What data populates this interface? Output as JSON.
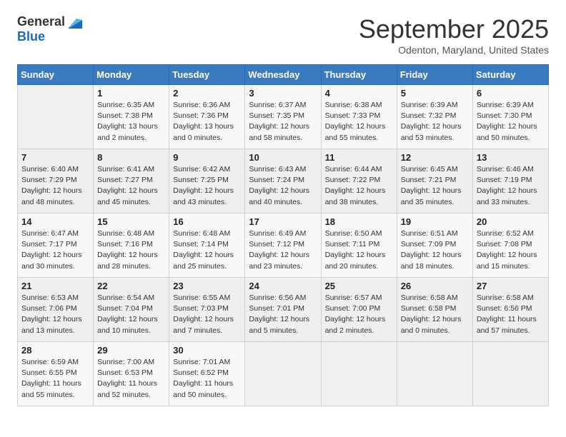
{
  "logo": {
    "general": "General",
    "blue": "Blue"
  },
  "title": "September 2025",
  "subtitle": "Odenton, Maryland, United States",
  "weekdays": [
    "Sunday",
    "Monday",
    "Tuesday",
    "Wednesday",
    "Thursday",
    "Friday",
    "Saturday"
  ],
  "weeks": [
    [
      {
        "day": "",
        "sunrise": "",
        "sunset": "",
        "daylight": ""
      },
      {
        "day": "1",
        "sunrise": "Sunrise: 6:35 AM",
        "sunset": "Sunset: 7:38 PM",
        "daylight": "Daylight: 13 hours and 2 minutes."
      },
      {
        "day": "2",
        "sunrise": "Sunrise: 6:36 AM",
        "sunset": "Sunset: 7:36 PM",
        "daylight": "Daylight: 13 hours and 0 minutes."
      },
      {
        "day": "3",
        "sunrise": "Sunrise: 6:37 AM",
        "sunset": "Sunset: 7:35 PM",
        "daylight": "Daylight: 12 hours and 58 minutes."
      },
      {
        "day": "4",
        "sunrise": "Sunrise: 6:38 AM",
        "sunset": "Sunset: 7:33 PM",
        "daylight": "Daylight: 12 hours and 55 minutes."
      },
      {
        "day": "5",
        "sunrise": "Sunrise: 6:39 AM",
        "sunset": "Sunset: 7:32 PM",
        "daylight": "Daylight: 12 hours and 53 minutes."
      },
      {
        "day": "6",
        "sunrise": "Sunrise: 6:39 AM",
        "sunset": "Sunset: 7:30 PM",
        "daylight": "Daylight: 12 hours and 50 minutes."
      }
    ],
    [
      {
        "day": "7",
        "sunrise": "Sunrise: 6:40 AM",
        "sunset": "Sunset: 7:29 PM",
        "daylight": "Daylight: 12 hours and 48 minutes."
      },
      {
        "day": "8",
        "sunrise": "Sunrise: 6:41 AM",
        "sunset": "Sunset: 7:27 PM",
        "daylight": "Daylight: 12 hours and 45 minutes."
      },
      {
        "day": "9",
        "sunrise": "Sunrise: 6:42 AM",
        "sunset": "Sunset: 7:25 PM",
        "daylight": "Daylight: 12 hours and 43 minutes."
      },
      {
        "day": "10",
        "sunrise": "Sunrise: 6:43 AM",
        "sunset": "Sunset: 7:24 PM",
        "daylight": "Daylight: 12 hours and 40 minutes."
      },
      {
        "day": "11",
        "sunrise": "Sunrise: 6:44 AM",
        "sunset": "Sunset: 7:22 PM",
        "daylight": "Daylight: 12 hours and 38 minutes."
      },
      {
        "day": "12",
        "sunrise": "Sunrise: 6:45 AM",
        "sunset": "Sunset: 7:21 PM",
        "daylight": "Daylight: 12 hours and 35 minutes."
      },
      {
        "day": "13",
        "sunrise": "Sunrise: 6:46 AM",
        "sunset": "Sunset: 7:19 PM",
        "daylight": "Daylight: 12 hours and 33 minutes."
      }
    ],
    [
      {
        "day": "14",
        "sunrise": "Sunrise: 6:47 AM",
        "sunset": "Sunset: 7:17 PM",
        "daylight": "Daylight: 12 hours and 30 minutes."
      },
      {
        "day": "15",
        "sunrise": "Sunrise: 6:48 AM",
        "sunset": "Sunset: 7:16 PM",
        "daylight": "Daylight: 12 hours and 28 minutes."
      },
      {
        "day": "16",
        "sunrise": "Sunrise: 6:48 AM",
        "sunset": "Sunset: 7:14 PM",
        "daylight": "Daylight: 12 hours and 25 minutes."
      },
      {
        "day": "17",
        "sunrise": "Sunrise: 6:49 AM",
        "sunset": "Sunset: 7:12 PM",
        "daylight": "Daylight: 12 hours and 23 minutes."
      },
      {
        "day": "18",
        "sunrise": "Sunrise: 6:50 AM",
        "sunset": "Sunset: 7:11 PM",
        "daylight": "Daylight: 12 hours and 20 minutes."
      },
      {
        "day": "19",
        "sunrise": "Sunrise: 6:51 AM",
        "sunset": "Sunset: 7:09 PM",
        "daylight": "Daylight: 12 hours and 18 minutes."
      },
      {
        "day": "20",
        "sunrise": "Sunrise: 6:52 AM",
        "sunset": "Sunset: 7:08 PM",
        "daylight": "Daylight: 12 hours and 15 minutes."
      }
    ],
    [
      {
        "day": "21",
        "sunrise": "Sunrise: 6:53 AM",
        "sunset": "Sunset: 7:06 PM",
        "daylight": "Daylight: 12 hours and 13 minutes."
      },
      {
        "day": "22",
        "sunrise": "Sunrise: 6:54 AM",
        "sunset": "Sunset: 7:04 PM",
        "daylight": "Daylight: 12 hours and 10 minutes."
      },
      {
        "day": "23",
        "sunrise": "Sunrise: 6:55 AM",
        "sunset": "Sunset: 7:03 PM",
        "daylight": "Daylight: 12 hours and 7 minutes."
      },
      {
        "day": "24",
        "sunrise": "Sunrise: 6:56 AM",
        "sunset": "Sunset: 7:01 PM",
        "daylight": "Daylight: 12 hours and 5 minutes."
      },
      {
        "day": "25",
        "sunrise": "Sunrise: 6:57 AM",
        "sunset": "Sunset: 7:00 PM",
        "daylight": "Daylight: 12 hours and 2 minutes."
      },
      {
        "day": "26",
        "sunrise": "Sunrise: 6:58 AM",
        "sunset": "Sunset: 6:58 PM",
        "daylight": "Daylight: 12 hours and 0 minutes."
      },
      {
        "day": "27",
        "sunrise": "Sunrise: 6:58 AM",
        "sunset": "Sunset: 6:56 PM",
        "daylight": "Daylight: 11 hours and 57 minutes."
      }
    ],
    [
      {
        "day": "28",
        "sunrise": "Sunrise: 6:59 AM",
        "sunset": "Sunset: 6:55 PM",
        "daylight": "Daylight: 11 hours and 55 minutes."
      },
      {
        "day": "29",
        "sunrise": "Sunrise: 7:00 AM",
        "sunset": "Sunset: 6:53 PM",
        "daylight": "Daylight: 11 hours and 52 minutes."
      },
      {
        "day": "30",
        "sunrise": "Sunrise: 7:01 AM",
        "sunset": "Sunset: 6:52 PM",
        "daylight": "Daylight: 11 hours and 50 minutes."
      },
      {
        "day": "",
        "sunrise": "",
        "sunset": "",
        "daylight": ""
      },
      {
        "day": "",
        "sunrise": "",
        "sunset": "",
        "daylight": ""
      },
      {
        "day": "",
        "sunrise": "",
        "sunset": "",
        "daylight": ""
      },
      {
        "day": "",
        "sunrise": "",
        "sunset": "",
        "daylight": ""
      }
    ]
  ]
}
